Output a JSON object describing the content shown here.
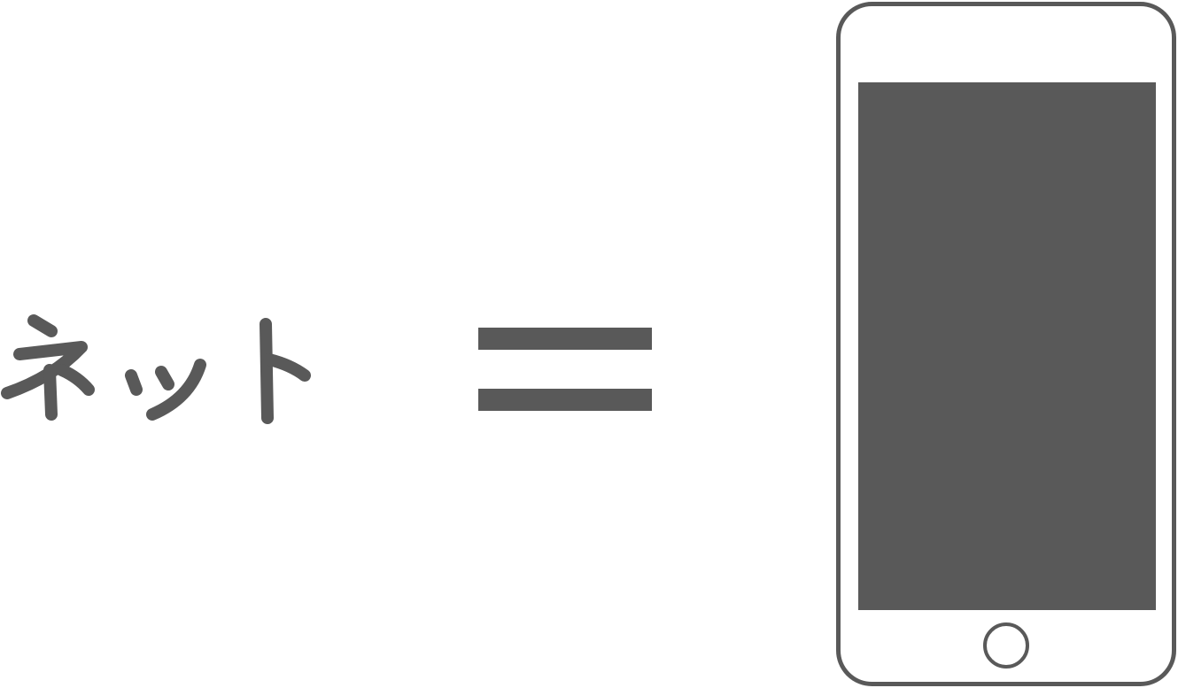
{
  "word": {
    "text": "ネット"
  },
  "colors": {
    "ink": "#595959",
    "background": "#ffffff"
  },
  "icons": {
    "equals": "equals-sign-icon",
    "phone": "smartphone-icon",
    "home_button": "home-button-icon"
  }
}
